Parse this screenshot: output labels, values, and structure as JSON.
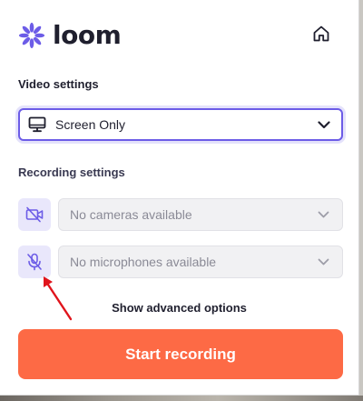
{
  "brand": {
    "name": "loom",
    "logo_color": "#6c5ce7"
  },
  "header": {
    "home_icon": "home-icon"
  },
  "video_settings": {
    "label": "Video settings",
    "selected": "Screen Only",
    "icon": "monitor-icon"
  },
  "recording_settings": {
    "label": "Recording settings",
    "camera": {
      "icon": "camera-off-icon",
      "placeholder": "No cameras available"
    },
    "microphone": {
      "icon": "microphone-off-icon",
      "placeholder": "No microphones available"
    }
  },
  "advanced_options": "Show advanced options",
  "start_button": {
    "label": "Start recording",
    "color": "#fd6a45"
  },
  "annotation": {
    "color": "#e0141c"
  }
}
